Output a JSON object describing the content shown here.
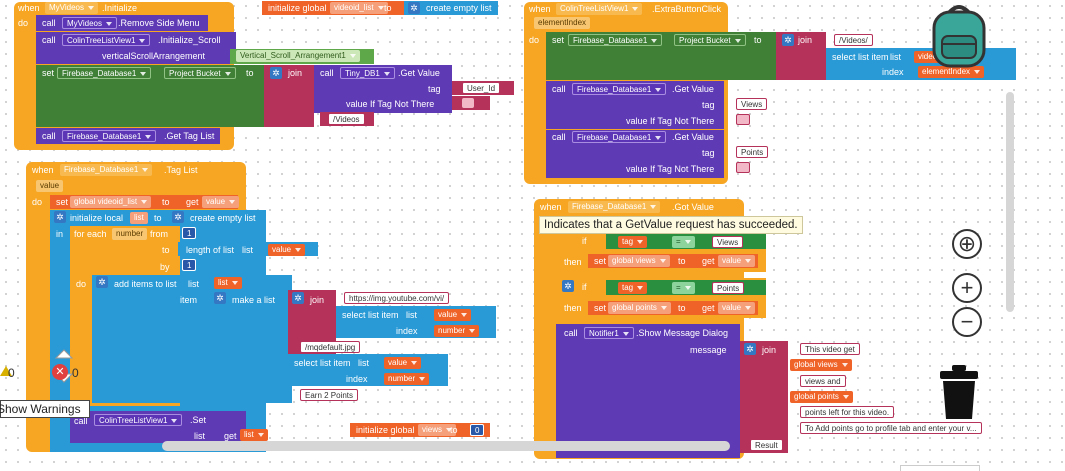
{
  "blocks": {
    "b1": {
      "when": "when",
      "component": "MyVideos",
      "event": ".Initialize",
      "do": "do",
      "call": "call",
      "remove_comp": "MyVideos",
      "remove_method": ".Remove Side Menu",
      "init_comp": "ColinTreeListView1",
      "init_method": ".Initialize_Scroll",
      "param_label": "verticalScrollArrangement",
      "param_value": "Vertical_Scroll_Arrangement1",
      "set": "set",
      "set_comp": "Firebase_Database1",
      "set_prop": "Project Bucket",
      "to": "to",
      "join": "join",
      "get_comp": "Tiny_DB1",
      "get_method": ".Get Value",
      "tag_label": "tag",
      "tag_value": "User_Id",
      "vitnt_label": "value If Tag Not There",
      "videos_text": "/Videos",
      "taglist_comp": "Firebase_Database1",
      "taglist_method": ".Get Tag List"
    },
    "b2": {
      "title": "initialize global",
      "name": "videoid_list",
      "to": "to",
      "create": "create empty list"
    },
    "b3": {
      "when": "when",
      "component": "ColinTreeListView1",
      "event": ".ExtraButtonClick",
      "param": "elementIndex",
      "do": "do",
      "set": "set",
      "set_comp": "Firebase_Database1",
      "set_prop": "Project Bucket",
      "to": "to",
      "join": "join",
      "videos_text": "/Videos/",
      "select_label": "select list item",
      "list_label": "list",
      "get": "get",
      "list_value": "videoid_list",
      "index_label": "index",
      "index_value": "elementIndex",
      "call1": "call",
      "comp1": "Firebase_Database1",
      "method1": ".Get Value",
      "tag_label": "tag",
      "tag1": "Views",
      "vitnt_label": "value If Tag Not There",
      "call2": "call",
      "comp2": "Firebase_Database1",
      "method2": ".Get Value",
      "tag2": "Points"
    },
    "b4": {
      "when": "when",
      "component": "Firebase_Database1",
      "event": ".Tag List",
      "param": "value",
      "do": "do",
      "set": "set",
      "set_var": "global videoid_list",
      "to": "to",
      "get": "get",
      "get_val": "value",
      "init_local": "initialize local",
      "local_name": "list",
      "local_to": "to",
      "create": "create empty list",
      "in": "in",
      "for_each": "for each",
      "for_var": "number",
      "from": "from",
      "from_val": "1",
      "to2": "to",
      "length": "length of list",
      "list_label": "list",
      "get_value": "value",
      "by": "by",
      "by_val": "1",
      "do2": "do",
      "add_items": "add items to list",
      "list_label2": "list",
      "get_list": "list",
      "item_label": "item",
      "make_list": "make a list",
      "join": "join",
      "url_prefix": "https://img.youtube.com/vi/",
      "select_label": "select list item",
      "list_label3": "list",
      "get_value2": "value",
      "index_label": "index",
      "get_number": "number",
      "url_suffix": "/mqdefault.jpg",
      "select2": "select list item",
      "list4": "list",
      "get_value3": "value",
      "index2": "index",
      "get_number2": "number",
      "earn": "Earn 2 Points",
      "call": "call",
      "set_comp": "ColinTreeListView1",
      "set_method": ".Set",
      "list_label5": "list",
      "get_list2": "list"
    },
    "b5": {
      "when": "when",
      "component": "Firebase_Database1",
      "event": ".Got Value",
      "tooltip": "Indicates that a GetValue request has succeeded.",
      "if": "if",
      "get_tag": "tag",
      "eq": "=",
      "views": "Views",
      "then": "then",
      "set1": "set",
      "var1": "global views",
      "to1": "to",
      "get1": "get",
      "val1": "value",
      "get_tag2": "tag",
      "eq2": "=",
      "points": "Points",
      "then2": "then",
      "set2": "set",
      "var2": "global points",
      "to2": "to",
      "get2": "get",
      "val2": "value",
      "call": "call",
      "notifier": "Notifier1",
      "method": ".Show Message Dialog",
      "message": "message",
      "join": "join",
      "t1": "This video get",
      "g1": "global views",
      "t2": "views and",
      "g2": "global points",
      "t3": "points left for this video.",
      "t4": "To Add points go to profile tab and enter your v...",
      "result": "Result"
    },
    "b6": {
      "title": "initialize global",
      "name": "views",
      "to": "to",
      "value": "0"
    }
  },
  "warnings": {
    "count1": "0",
    "count2": "0",
    "label": "Show Warnings"
  },
  "icons": {
    "zoom_in": "+",
    "zoom_out": "−",
    "center": "⊕"
  },
  "colors": {
    "event": "#f6a623",
    "component_call": "#5f3ab5",
    "setter": "#3f7f36",
    "text": "#b5325a",
    "list": "#2a9ad6",
    "variable": "#ef6228"
  }
}
